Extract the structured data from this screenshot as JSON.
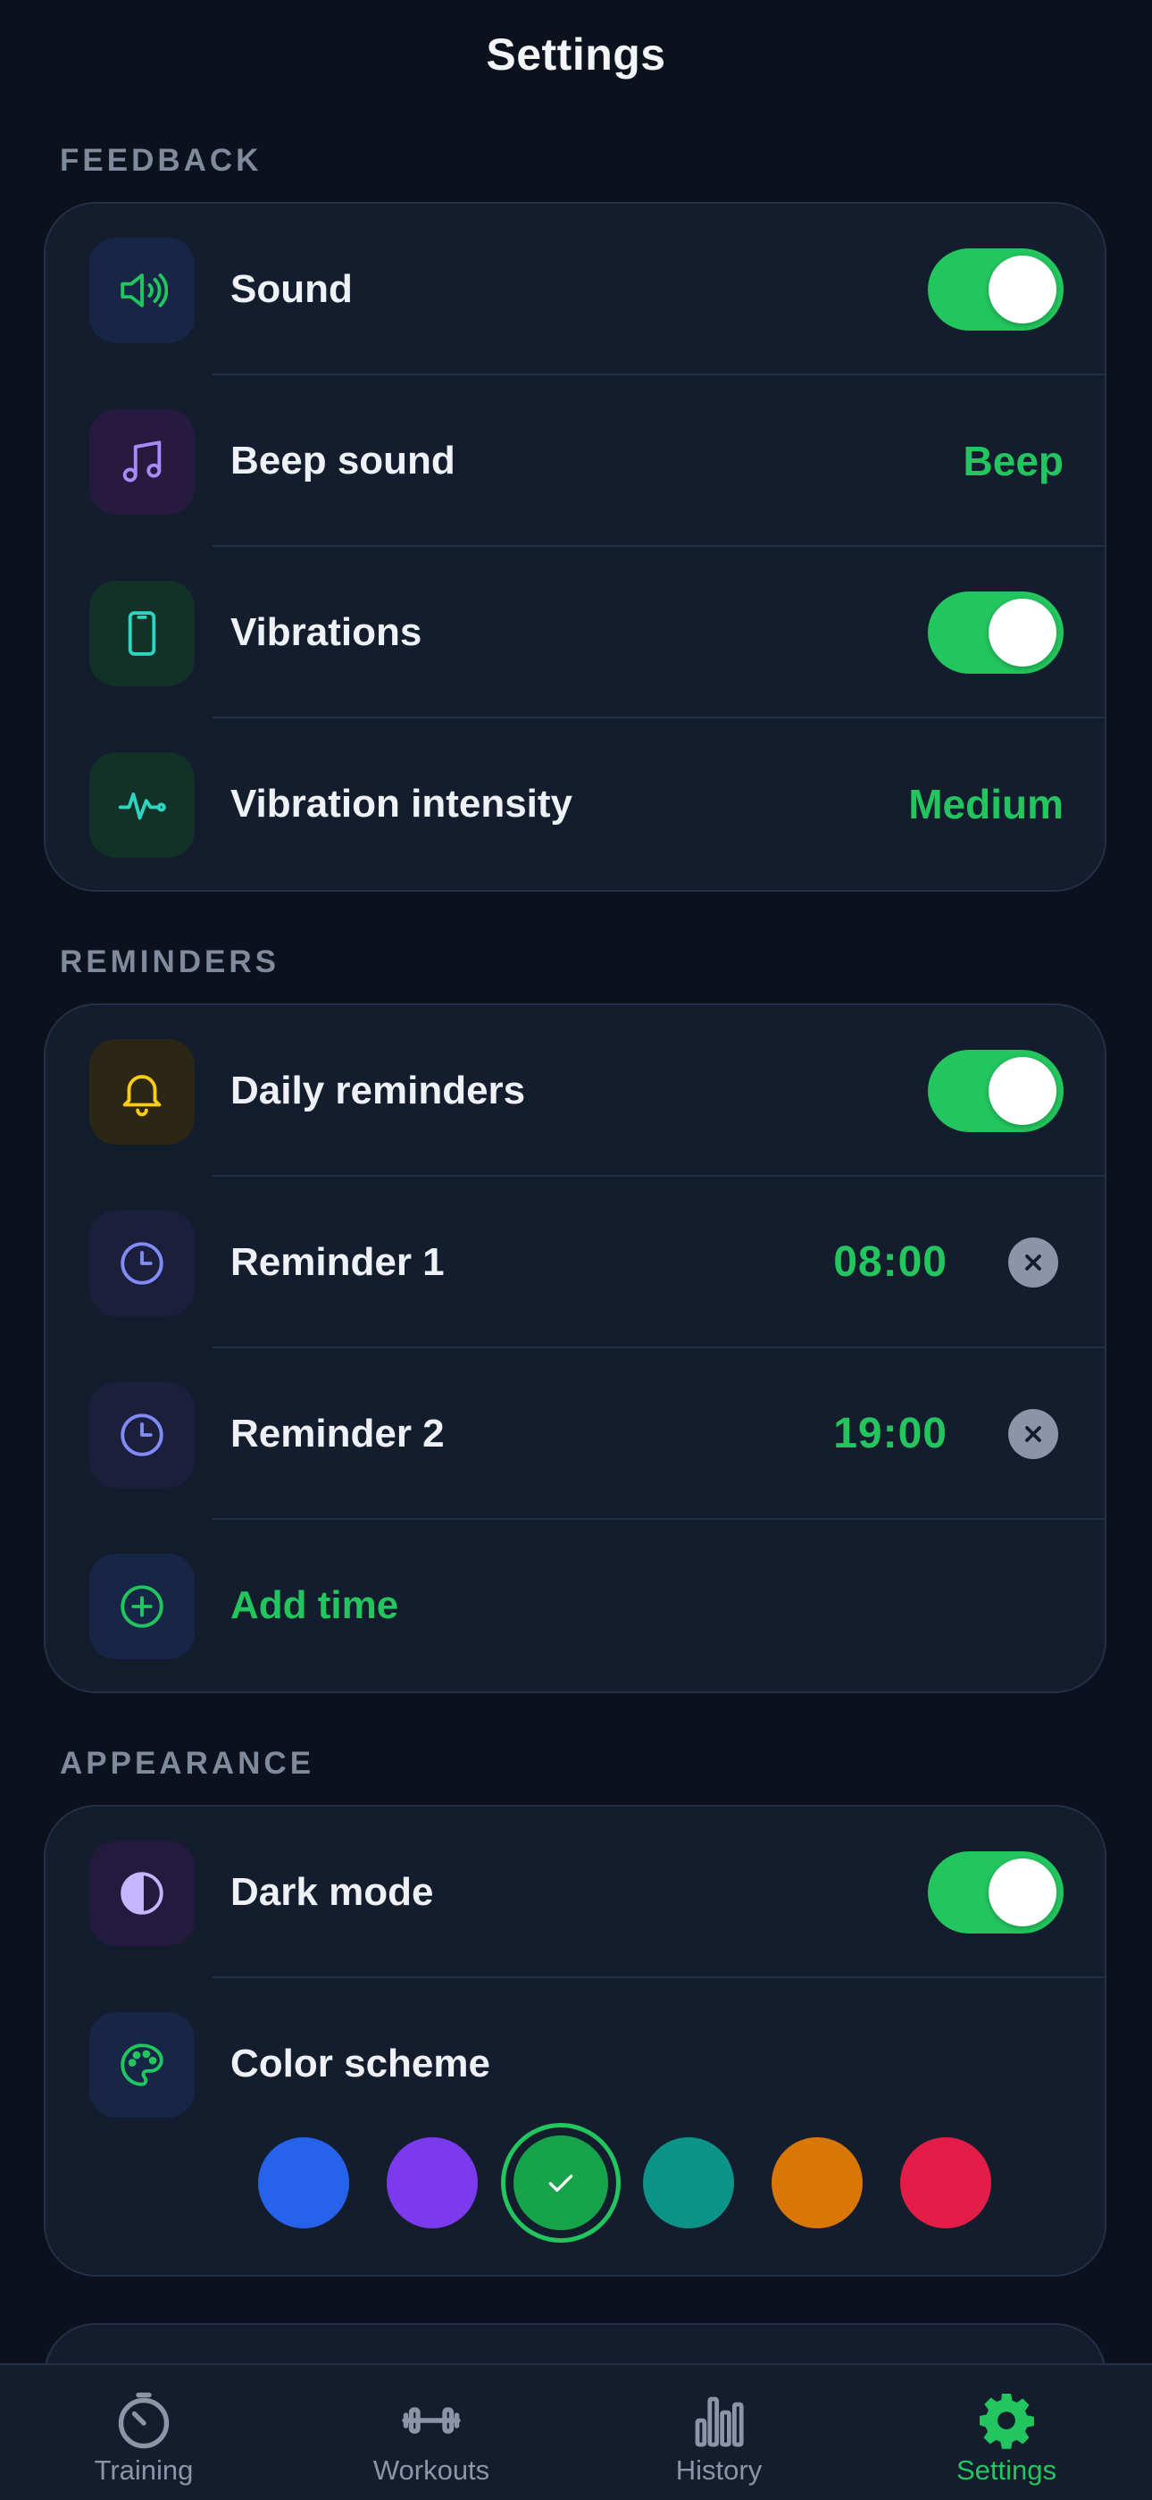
{
  "header": {
    "title": "Settings"
  },
  "sections": {
    "feedback": {
      "label": "FEEDBACK",
      "rows": [
        {
          "label": "Sound",
          "toggle": true
        },
        {
          "label": "Beep sound",
          "value": "Beep"
        },
        {
          "label": "Vibrations",
          "toggle": true
        },
        {
          "label": "Vibration intensity",
          "value": "Medium"
        }
      ]
    },
    "reminders": {
      "label": "REMINDERS",
      "rows": [
        {
          "label": "Daily reminders",
          "toggle": true
        },
        {
          "label": "Reminder 1",
          "value": "08:00"
        },
        {
          "label": "Reminder 2",
          "value": "19:00"
        },
        {
          "label": "Add time"
        }
      ]
    },
    "appearance": {
      "label": "APPEARANCE",
      "rows": [
        {
          "label": "Dark mode",
          "toggle": true
        },
        {
          "label": "Color scheme"
        }
      ],
      "color_options": [
        "#2563eb",
        "#7c3aed",
        "#16a34a",
        "#0d9488",
        "#d97706",
        "#e11d48"
      ],
      "selected_color": "#16a34a"
    }
  },
  "tabbar": {
    "items": [
      {
        "label": "Training",
        "icon": "timer-icon"
      },
      {
        "label": "Workouts",
        "icon": "dumbbell-icon"
      },
      {
        "label": "History",
        "icon": "bar-chart-icon"
      },
      {
        "label": "Settings",
        "icon": "gear-icon",
        "active": true
      }
    ]
  },
  "colors": {
    "accent": "#22c55e",
    "background": "#0b111d",
    "card": "#141d2d"
  }
}
